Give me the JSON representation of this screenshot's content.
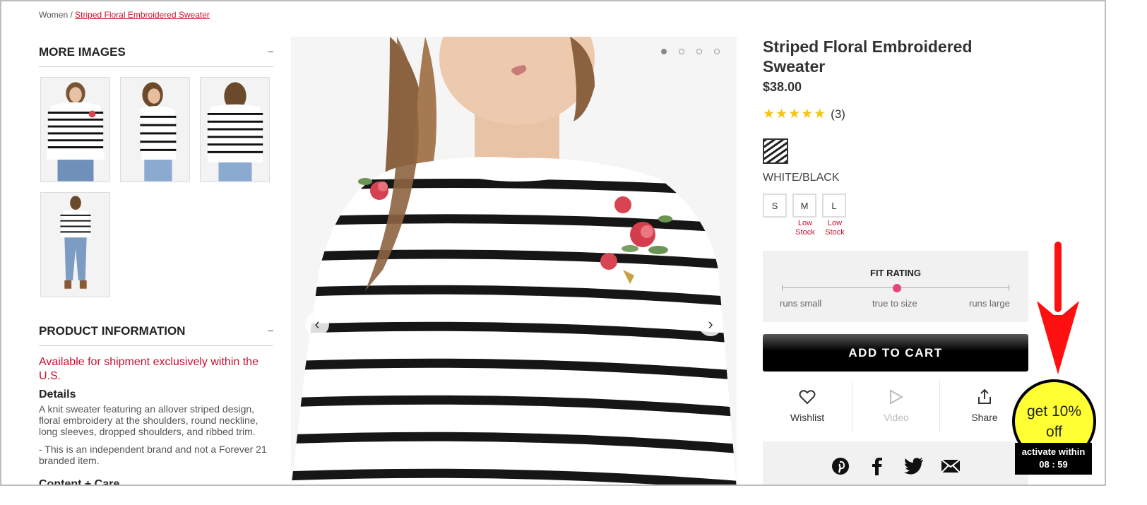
{
  "breadcrumb": {
    "root": "Women",
    "separator": " / ",
    "current": "Striped Floral Embroidered Sweater"
  },
  "more_images": {
    "title": "MORE IMAGES",
    "toggle": "–"
  },
  "product_information": {
    "title": "PRODUCT INFORMATION",
    "toggle": "–",
    "shipping_note": "Available for shipment exclusively within the U.S.",
    "details_heading": "Details",
    "details_text": "A knit sweater featuring an allover striped design, floral embroidery at the shoulders, round neckline, long sleeves, dropped shoulders, and ribbed trim.",
    "brand_note": "- This is an independent brand and not a Forever 21 branded item.",
    "content_care_heading": "Content + Care"
  },
  "gallery": {
    "prev_symbol": "‹",
    "next_symbol": "›",
    "active_index": 0,
    "dot_count": 4
  },
  "product": {
    "title": "Striped Floral Embroidered Sweater",
    "price": "$38.00",
    "stars": "★★★★★",
    "rating": 5,
    "review_count": "(3)",
    "color_name": "WHITE/BLACK",
    "sizes": [
      {
        "label": "S",
        "stock": ""
      },
      {
        "label": "M",
        "stock": "Low Stock"
      },
      {
        "label": "L",
        "stock": "Low Stock"
      }
    ]
  },
  "fit_rating": {
    "title": "FIT RATING",
    "labels": [
      "runs small",
      "true to size",
      "runs large"
    ],
    "value": 0.5
  },
  "cart": {
    "add_label": "ADD TO CART"
  },
  "actions": {
    "wishlist": "Wishlist",
    "video": "Video",
    "share": "Share"
  },
  "social_icons": [
    "pinterest-icon",
    "facebook-icon",
    "twitter-icon",
    "email-icon"
  ],
  "promo": {
    "offer": "get 10% off",
    "activate_label": "activate within",
    "timer": "08 : 59"
  },
  "colors": {
    "accent_red": "#c8102e",
    "star": "#f5c518",
    "fit_marker": "#e8437d",
    "promo_yellow": "#ffff33"
  }
}
